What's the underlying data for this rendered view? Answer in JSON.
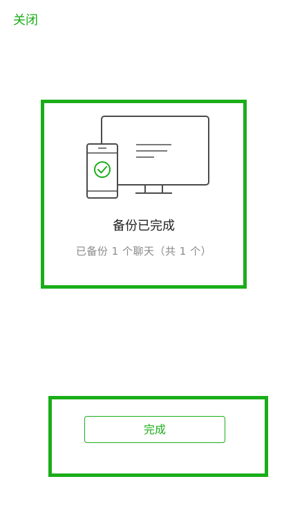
{
  "header": {
    "close_label": "关闭"
  },
  "status": {
    "title": "备份已完成",
    "subtitle": "已备份 1 个聊天（共 1 个）"
  },
  "actions": {
    "done_label": "完成"
  },
  "colors": {
    "accent": "#1aad19",
    "title_text": "#222222",
    "subtitle_text": "#8a8a8a",
    "illustration_stroke": "#4a4a4a"
  }
}
